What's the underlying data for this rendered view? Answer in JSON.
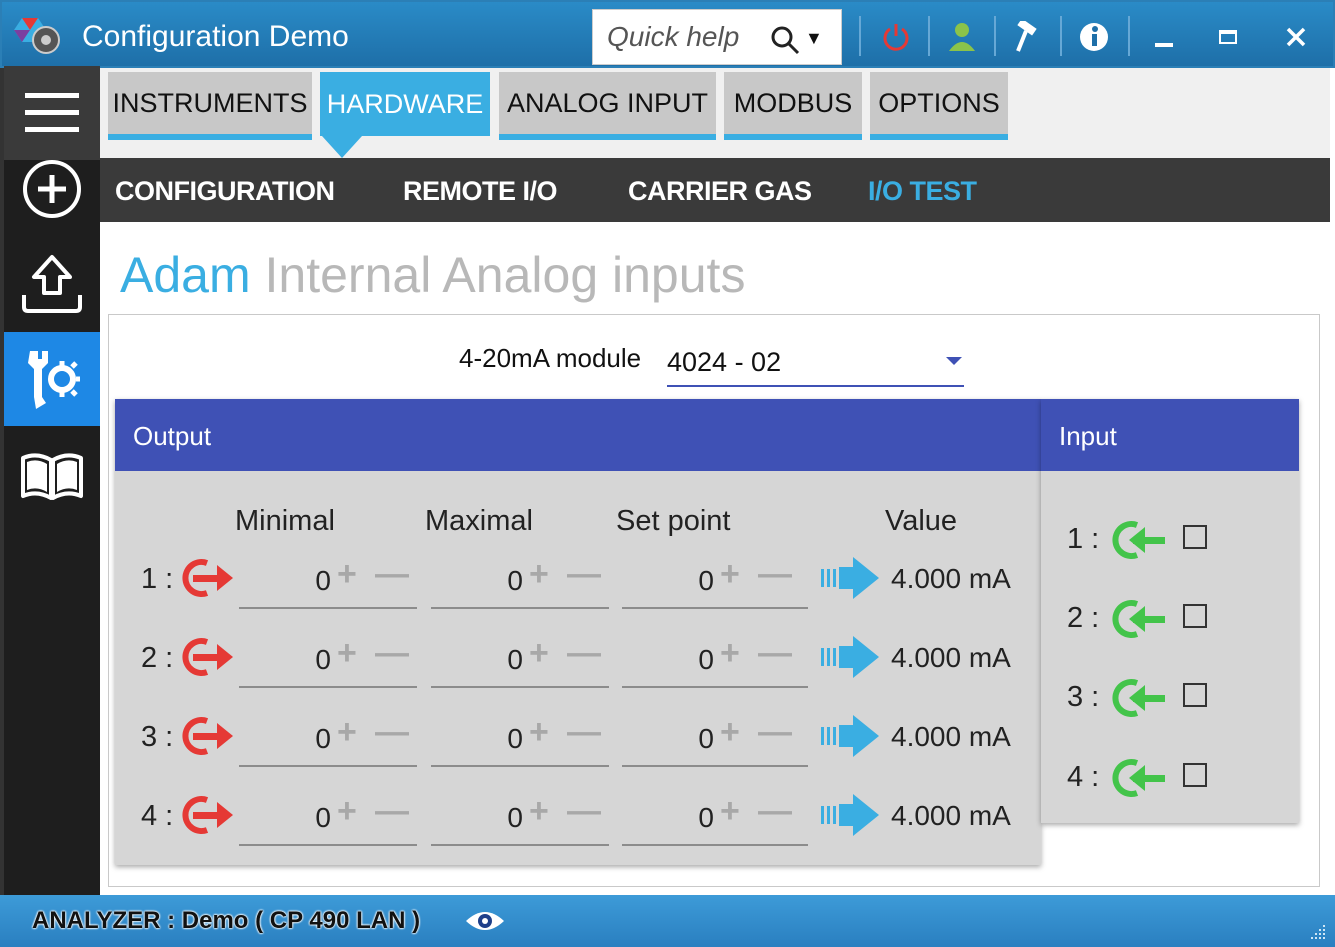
{
  "window": {
    "title": "Configuration Demo",
    "quick_help_placeholder": "Quick help"
  },
  "titlebar_icons": [
    "power-icon",
    "user-icon",
    "hammer-icon",
    "info-icon",
    "minimize-icon",
    "maximize-icon",
    "close-icon"
  ],
  "sidebar": {
    "items": [
      "menu-icon",
      "add-icon",
      "upload-icon",
      "tools-icon",
      "book-icon"
    ],
    "active": "tools-icon"
  },
  "main_tabs": [
    {
      "label": "INSTRUMENTS"
    },
    {
      "label": "HARDWARE"
    },
    {
      "label": "ANALOG INPUT"
    },
    {
      "label": "MODBUS"
    },
    {
      "label": "OPTIONS"
    }
  ],
  "main_tab_active": "HARDWARE",
  "sub_tabs": [
    {
      "label": "CONFIGURATION"
    },
    {
      "label": "REMOTE I/O"
    },
    {
      "label": "CARRIER GAS"
    },
    {
      "label": "I/O TEST"
    }
  ],
  "sub_tab_active": "I/O TEST",
  "page_title": {
    "part1": "Adam",
    "part2": "Internal Analog inputs"
  },
  "module": {
    "label": "4-20mA module",
    "selected": "4024 - 02"
  },
  "output": {
    "header": "Output",
    "columns": {
      "minimal": "Minimal",
      "maximal": "Maximal",
      "set_point": "Set point",
      "value": "Value"
    },
    "rows": [
      {
        "index": "1 :",
        "minimal": "0",
        "maximal": "0",
        "set_point": "0",
        "value": "4.000 mA"
      },
      {
        "index": "2 :",
        "minimal": "0",
        "maximal": "0",
        "set_point": "0",
        "value": "4.000 mA"
      },
      {
        "index": "3 :",
        "minimal": "0",
        "maximal": "0",
        "set_point": "0",
        "value": "4.000 mA"
      },
      {
        "index": "4 :",
        "minimal": "0",
        "maximal": "0",
        "set_point": "0",
        "value": "4.000 mA"
      }
    ],
    "plus": "+",
    "minus": "—"
  },
  "input": {
    "header": "Input",
    "rows": [
      {
        "index": "1 :",
        "checked": false
      },
      {
        "index": "2 :",
        "checked": false
      },
      {
        "index": "3 :",
        "checked": false
      },
      {
        "index": "4 :",
        "checked": false
      }
    ]
  },
  "status": {
    "text": "ANALYZER :  Demo ( CP 490 LAN )"
  },
  "colors": {
    "accent": "#3aaee2",
    "header_blue": "#3f51b5",
    "output_red": "#e53935",
    "input_green": "#43c44a"
  }
}
